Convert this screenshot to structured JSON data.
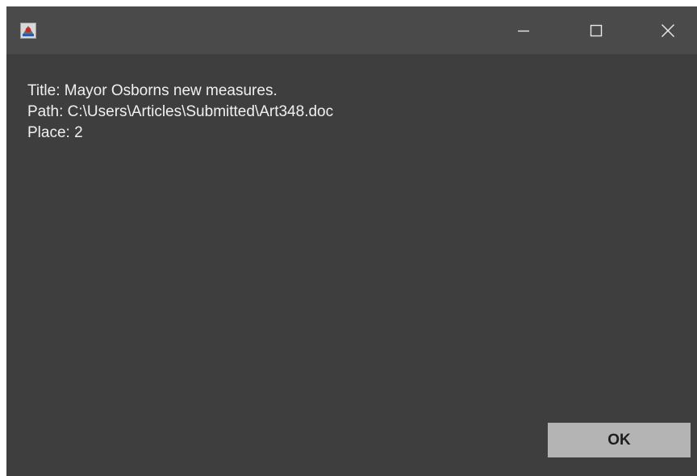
{
  "window": {
    "background": "#3e3e3e",
    "titlebar_background": "#4a4a4a",
    "app_icon": "java-app-icon",
    "controls": {
      "minimize_icon": "minimize-icon",
      "maximize_icon": "maximize-icon",
      "close_icon": "close-icon"
    }
  },
  "message": {
    "title_line": "Title: Mayor Osborns new measures.",
    "path_line": "Path: C:\\Users\\Articles\\Submitted\\Art348.doc",
    "place_line": "Place: 2"
  },
  "buttons": {
    "ok_label": "OK",
    "ok_background": "#b4b4b4"
  }
}
